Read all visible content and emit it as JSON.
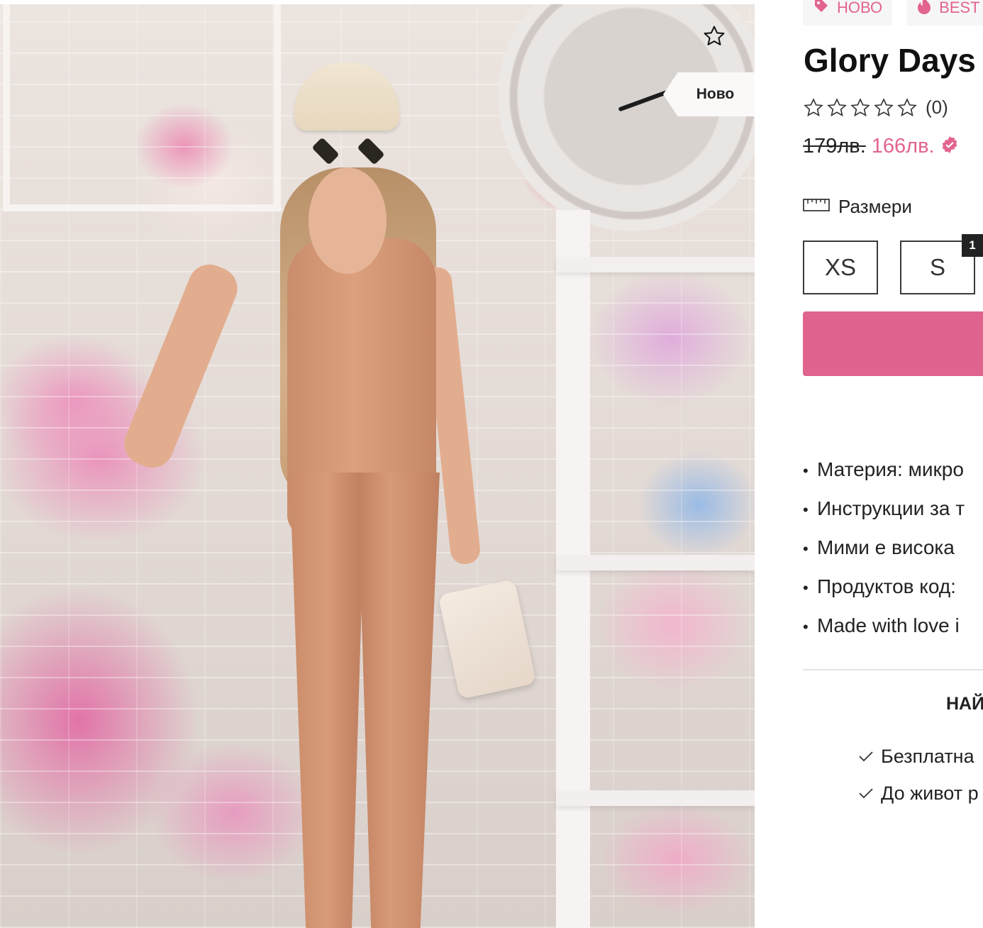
{
  "gallery": {
    "image_alt_icon": "product-photo",
    "ribbon_label": "Ново",
    "wishlist_icon": "star-outline-icon"
  },
  "product": {
    "badges": [
      {
        "icon": "tag-icon",
        "label": "НОВО"
      },
      {
        "icon": "fire-icon",
        "label": "BEST"
      }
    ],
    "title": "Glory Days",
    "rating": {
      "stars": 0,
      "max": 5,
      "count_label": "(0)"
    },
    "old_price": "179лв.",
    "new_price": "166лв.",
    "price_badge_icon": "verified-badge-icon",
    "sizes_label": "Размери",
    "sizes": [
      {
        "label": "XS",
        "stock": null
      },
      {
        "label": "S",
        "stock": "1"
      }
    ],
    "features": [
      "Материя: микро",
      "Инструкции за т",
      "Мими е висока",
      "Продуктов код:",
      "Made with love i"
    ],
    "section_heading": "НАЙ",
    "perks": [
      "Безплатна",
      "До живот р"
    ]
  },
  "colors": {
    "accent": "#e0628f",
    "price_accent": "#e2648f",
    "text": "#222222",
    "badge_bg": "#f6f6f6"
  }
}
